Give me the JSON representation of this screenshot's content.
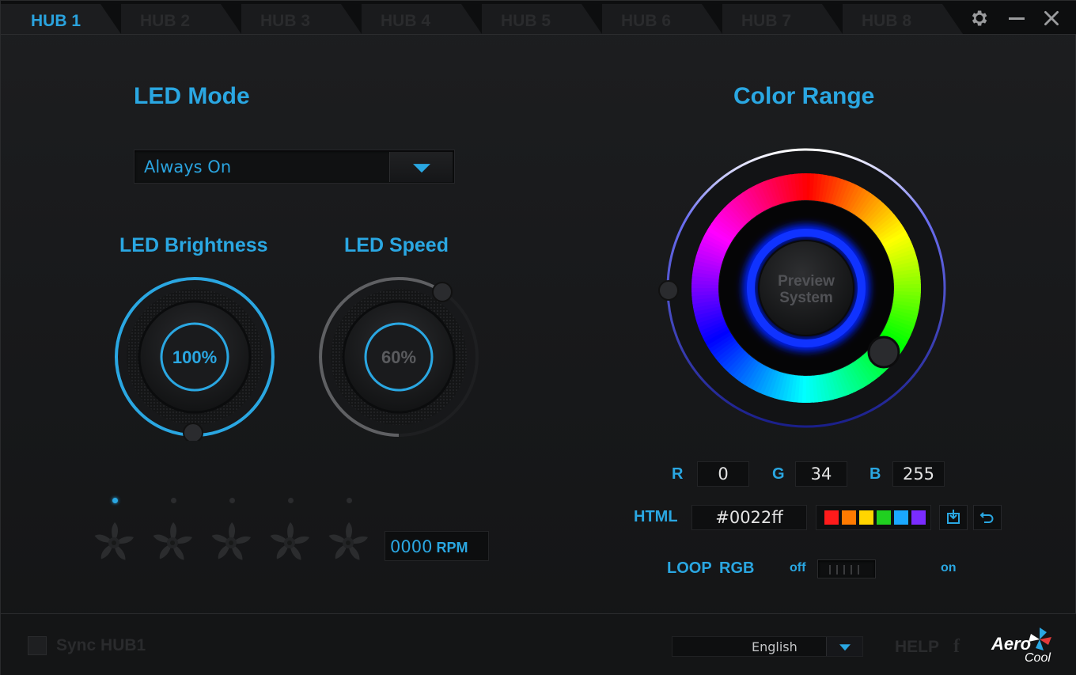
{
  "tabs": [
    {
      "label": "HUB 1",
      "active": true
    },
    {
      "label": "HUB 2",
      "active": false
    },
    {
      "label": "HUB 3",
      "active": false
    },
    {
      "label": "HUB 4",
      "active": false
    },
    {
      "label": "HUB 5",
      "active": false
    },
    {
      "label": "HUB 6",
      "active": false
    },
    {
      "label": "HUB 7",
      "active": false
    },
    {
      "label": "HUB 8",
      "active": false
    }
  ],
  "window_controls": {
    "settings_icon": "gear-icon",
    "minimize_icon": "minimize-icon",
    "close_icon": "close-icon"
  },
  "led_mode": {
    "title": "LED Mode",
    "selected": "Always On"
  },
  "brightness": {
    "title": "LED Brightness",
    "value_label": "100%",
    "value": 100
  },
  "speed": {
    "title": "LED Speed",
    "value_label": "60%",
    "value": 60
  },
  "fans": {
    "count": 5,
    "active_index": 0,
    "rpm_value": "0000",
    "rpm_unit": "RPM"
  },
  "color": {
    "title": "Color Range",
    "preview_label_line1": "Preview",
    "preview_label_line2": "System",
    "r_label": "R",
    "r": "0",
    "g_label": "G",
    "g": "34",
    "b_label": "B",
    "b": "255",
    "html_label": "HTML",
    "html_value": "#0022ff",
    "current_color": "#0022ff",
    "swatches": [
      "#ff1b1b",
      "#ff7a00",
      "#ffd500",
      "#20d020",
      "#1aa8ff",
      "#7a2cff"
    ],
    "save_icon": "save-icon",
    "reset_icon": "undo-icon"
  },
  "loop_rgb": {
    "label_loop": "LOOP",
    "label_rgb": "RGB",
    "off_label": "off",
    "on_label": "on",
    "state": "off"
  },
  "footer": {
    "sync_label": "Sync HUB1",
    "sync_checked": false,
    "language": "English",
    "help_label": "HELP",
    "facebook_icon_text": "f",
    "logo_line1": "Aero",
    "logo_line2": "Cool"
  },
  "colors": {
    "accent": "#2aa7e2",
    "background": "#18191b",
    "inactive": "#2a2b2d"
  }
}
